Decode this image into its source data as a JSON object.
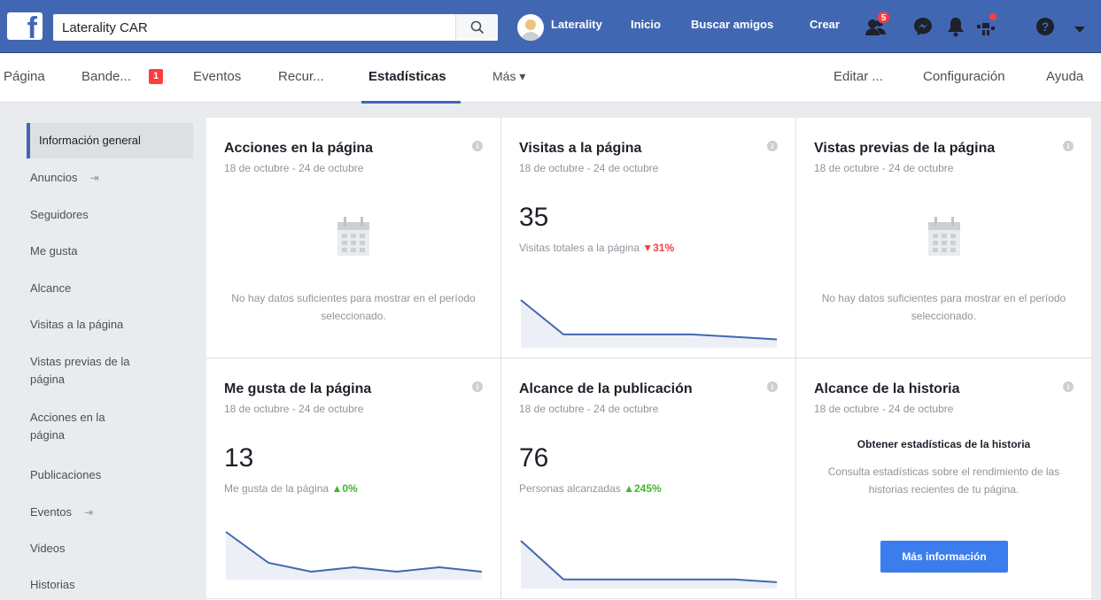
{
  "topbar": {
    "logo": "f",
    "search_value": "Laterality CAR",
    "profile_name": "Laterality",
    "nav": [
      "Inicio",
      "Buscar amigos",
      "Crear"
    ],
    "friend_requests_badge": "5",
    "colors": {
      "bar": "#4267b2",
      "badge": "#fa3e3e"
    }
  },
  "page_nav": {
    "tabs": [
      "Página",
      "Bande...",
      "Eventos",
      "Recur...",
      "Estadísticas",
      "Más ▾"
    ],
    "inbox_badge": "1",
    "right": [
      "Editar ...",
      "Configuración",
      "Ayuda"
    ]
  },
  "sidebar": {
    "items": [
      "Información general",
      "Anuncios",
      "Seguidores",
      "Me gusta",
      "Alcance",
      "Visitas a la página",
      "Vistas previas de la página",
      "Acciones en la página",
      "Publicaciones",
      "Eventos",
      "Videos",
      "Historias"
    ]
  },
  "cards": {
    "acciones": {
      "title": "Acciones en la página",
      "date": "18 de octubre - 24 de octubre",
      "empty": "No hay datos suficientes para mostrar en el período seleccionado."
    },
    "visitas": {
      "title": "Visitas a la página",
      "date": "18 de octubre - 24 de octubre",
      "value": "35",
      "metric": "Visitas totales a la página",
      "delta": "▼31%",
      "trend": [
        9,
        2,
        2,
        2,
        2,
        1.5,
        1
      ]
    },
    "vistas_previas": {
      "title": "Vistas previas de la página",
      "date": "18 de octubre - 24 de octubre",
      "empty": "No hay datos suficientes para mostrar en el período seleccionado."
    },
    "me_gusta": {
      "title": "Me gusta de la página",
      "date": "18 de octubre - 24 de octubre",
      "value": "13",
      "metric": "Me gusta de la página",
      "delta": "▲0%",
      "trend": [
        10,
        3,
        1,
        2,
        1,
        2,
        1
      ]
    },
    "alcance_pub": {
      "title": "Alcance de la publicación",
      "date": "18 de octubre - 24 de octubre",
      "value": "76",
      "metric": "Personas alcanzadas",
      "delta": "▲245%",
      "trend": [
        8,
        1,
        1,
        1,
        1,
        1,
        0.5
      ]
    },
    "historia": {
      "title": "Alcance de la historia",
      "date": "18 de octubre - 24 de octubre",
      "heading": "Obtener estadísticas de la historia",
      "text": "Consulta estadísticas sobre el rendimiento de las historias recientes de tu página.",
      "button": "Más información"
    }
  }
}
